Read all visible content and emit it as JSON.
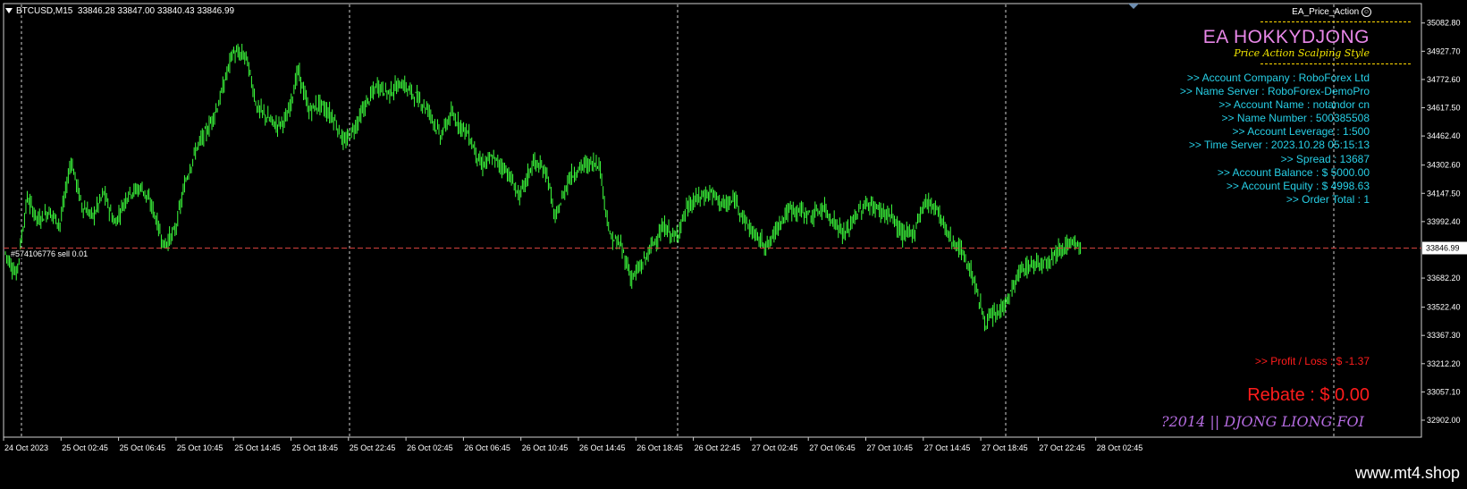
{
  "header": {
    "symbol": "BTCUSD,M15",
    "ohlc": "33846.28 33847.00 33840.43 33846.99"
  },
  "ea_label": "EA_Price_Action",
  "panel": {
    "title": "EA HOKKYDJONG",
    "subtitle": "Price Action Scalping Style",
    "info_lines": [
      ">> Account Company : RoboForex Ltd",
      ">> Name Server  : RoboForex-DemoPro",
      ">> Account Name  : notandor cn",
      ">> Name Number  : 500385508",
      ">> Account Leverage  : 1:500",
      ">> Time Server  : 2023.10.28 05:15:13",
      ">> Spread  : 13687",
      ">> Account Balance  : $ 5000.00",
      ">> Account Equity  : $ 4998.63",
      ">> Order Total  : 1"
    ],
    "profit_loss": ">> Profit / Loss  : $ -1.37",
    "rebate": "Rebate  : $ 0.00",
    "signature": "?2014 || DJONG LIONG FOI"
  },
  "order_label": "#574106776 sell 0.01",
  "current_price": "33846.99",
  "chart_data": {
    "type": "candlestick",
    "ylim": [
      32902.0,
      35160.0
    ],
    "y_ticks": [
      "35082.80",
      "34927.70",
      "34772.60",
      "34617.50",
      "34462.40",
      "34302.60",
      "34147.50",
      "33992.40",
      "33682.20",
      "33522.40",
      "33367.30",
      "33212.20",
      "33057.10",
      "32902.00"
    ],
    "x_ticks": [
      "24 Oct 2023",
      "25 Oct 02:45",
      "25 Oct 06:45",
      "25 Oct 10:45",
      "25 Oct 14:45",
      "25 Oct 18:45",
      "25 Oct 22:45",
      "26 Oct 02:45",
      "26 Oct 06:45",
      "26 Oct 10:45",
      "26 Oct 14:45",
      "26 Oct 18:45",
      "26 Oct 22:45",
      "27 Oct 02:45",
      "27 Oct 06:45",
      "27 Oct 10:45",
      "27 Oct 14:45",
      "27 Oct 18:45",
      "27 Oct 22:45",
      "28 Oct 02:45"
    ],
    "price_path": [
      [
        0,
        33820
      ],
      [
        8,
        33700
      ],
      [
        16,
        34120
      ],
      [
        24,
        34000
      ],
      [
        32,
        34050
      ],
      [
        40,
        33980
      ],
      [
        48,
        34330
      ],
      [
        56,
        34080
      ],
      [
        64,
        34020
      ],
      [
        72,
        34150
      ],
      [
        80,
        33980
      ],
      [
        90,
        34150
      ],
      [
        100,
        34180
      ],
      [
        108,
        34060
      ],
      [
        116,
        33860
      ],
      [
        124,
        33940
      ],
      [
        132,
        34220
      ],
      [
        140,
        34400
      ],
      [
        148,
        34500
      ],
      [
        156,
        34640
      ],
      [
        166,
        34920
      ],
      [
        176,
        34900
      ],
      [
        184,
        34620
      ],
      [
        192,
        34560
      ],
      [
        198,
        34520
      ],
      [
        206,
        34560
      ],
      [
        214,
        34820
      ],
      [
        222,
        34600
      ],
      [
        230,
        34640
      ],
      [
        240,
        34560
      ],
      [
        248,
        34420
      ],
      [
        256,
        34520
      ],
      [
        264,
        34640
      ],
      [
        272,
        34740
      ],
      [
        280,
        34700
      ],
      [
        290,
        34750
      ],
      [
        300,
        34680
      ],
      [
        310,
        34600
      ],
      [
        318,
        34460
      ],
      [
        326,
        34580
      ],
      [
        338,
        34480
      ],
      [
        348,
        34300
      ],
      [
        356,
        34340
      ],
      [
        366,
        34280
      ],
      [
        376,
        34130
      ],
      [
        386,
        34320
      ],
      [
        396,
        34260
      ],
      [
        402,
        34000
      ],
      [
        412,
        34230
      ],
      [
        422,
        34300
      ],
      [
        434,
        34320
      ],
      [
        442,
        33910
      ],
      [
        450,
        33860
      ],
      [
        458,
        33680
      ],
      [
        466,
        33760
      ],
      [
        474,
        33880
      ],
      [
        482,
        33960
      ],
      [
        490,
        33900
      ],
      [
        498,
        34060
      ],
      [
        506,
        34120
      ],
      [
        516,
        34150
      ],
      [
        526,
        34080
      ],
      [
        534,
        34110
      ],
      [
        542,
        33980
      ],
      [
        550,
        33900
      ],
      [
        558,
        33860
      ],
      [
        566,
        33990
      ],
      [
        574,
        34060
      ],
      [
        582,
        34050
      ],
      [
        590,
        34020
      ],
      [
        598,
        34070
      ],
      [
        606,
        33990
      ],
      [
        614,
        33920
      ],
      [
        622,
        34030
      ],
      [
        630,
        34090
      ],
      [
        638,
        34060
      ],
      [
        648,
        34020
      ],
      [
        656,
        33920
      ],
      [
        664,
        33930
      ],
      [
        672,
        34100
      ],
      [
        680,
        34080
      ],
      [
        690,
        33910
      ],
      [
        700,
        33820
      ],
      [
        708,
        33680
      ],
      [
        716,
        33440
      ],
      [
        726,
        33490
      ],
      [
        734,
        33580
      ],
      [
        742,
        33720
      ],
      [
        752,
        33760
      ],
      [
        762,
        33780
      ],
      [
        772,
        33850
      ],
      [
        780,
        33870
      ],
      [
        786,
        33848
      ]
    ]
  }
}
